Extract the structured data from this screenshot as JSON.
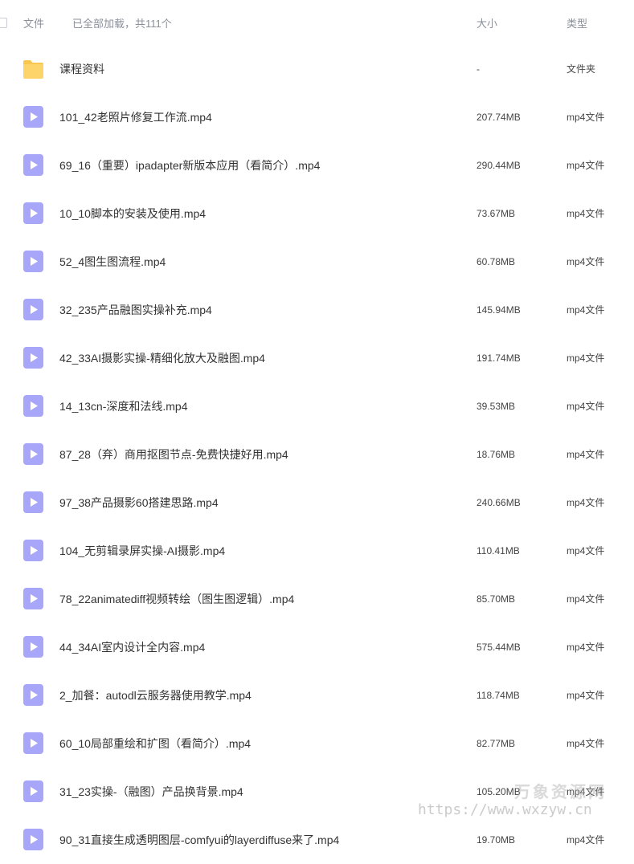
{
  "header": {
    "col_name": "文件",
    "status": "已全部加载，共111个",
    "col_size": "大小",
    "col_type": "类型"
  },
  "colors": {
    "folder": "#f9c64f",
    "video_icon": "#a8a6f8",
    "header_text": "#8a8f99",
    "row_text": "#333333"
  },
  "files": [
    {
      "icon": "folder-icon",
      "name": "课程资料",
      "size": "-",
      "type": "文件夹"
    },
    {
      "icon": "video-file-icon",
      "name": "101_42老照片修复工作流.mp4",
      "size": "207.74MB",
      "type": "mp4文件"
    },
    {
      "icon": "video-file-icon",
      "name": "69_16（重要）ipadapter新版本应用（看简介）.mp4",
      "size": "290.44MB",
      "type": "mp4文件"
    },
    {
      "icon": "video-file-icon",
      "name": "10_10脚本的安装及使用.mp4",
      "size": "73.67MB",
      "type": "mp4文件"
    },
    {
      "icon": "video-file-icon",
      "name": "52_4图生图流程.mp4",
      "size": "60.78MB",
      "type": "mp4文件"
    },
    {
      "icon": "video-file-icon",
      "name": "32_235产品融图实操补充.mp4",
      "size": "145.94MB",
      "type": "mp4文件"
    },
    {
      "icon": "video-file-icon",
      "name": "42_33AI摄影实操-精细化放大及融图.mp4",
      "size": "191.74MB",
      "type": "mp4文件"
    },
    {
      "icon": "video-file-icon",
      "name": "14_13cn-深度和法线.mp4",
      "size": "39.53MB",
      "type": "mp4文件"
    },
    {
      "icon": "video-file-icon",
      "name": "87_28（弃）商用抠图节点-免费快捷好用.mp4",
      "size": "18.76MB",
      "type": "mp4文件"
    },
    {
      "icon": "video-file-icon",
      "name": "97_38产品摄影60搭建思路.mp4",
      "size": "240.66MB",
      "type": "mp4文件"
    },
    {
      "icon": "video-file-icon",
      "name": "104_无剪辑录屏实操-AI摄影.mp4",
      "size": "110.41MB",
      "type": "mp4文件"
    },
    {
      "icon": "video-file-icon",
      "name": "78_22animatediff视频转绘（图生图逻辑）.mp4",
      "size": "85.70MB",
      "type": "mp4文件"
    },
    {
      "icon": "video-file-icon",
      "name": "44_34AI室内设计全内容.mp4",
      "size": "575.44MB",
      "type": "mp4文件"
    },
    {
      "icon": "video-file-icon",
      "name": "2_加餐：autodl云服务器使用教学.mp4",
      "size": "118.74MB",
      "type": "mp4文件"
    },
    {
      "icon": "video-file-icon",
      "name": "60_10局部重绘和扩图（看简介）.mp4",
      "size": "82.77MB",
      "type": "mp4文件"
    },
    {
      "icon": "video-file-icon",
      "name": "31_23实操-（融图）产品换背景.mp4",
      "size": "105.20MB",
      "type": "mp4文件"
    },
    {
      "icon": "video-file-icon",
      "name": "90_31直接生成透明图层-comfyui的layerdiffuse来了.mp4",
      "size": "19.70MB",
      "type": "mp4文件"
    }
  ],
  "watermark": {
    "name": "万象资源网",
    "url": "https://www.wxzyw.cn"
  }
}
